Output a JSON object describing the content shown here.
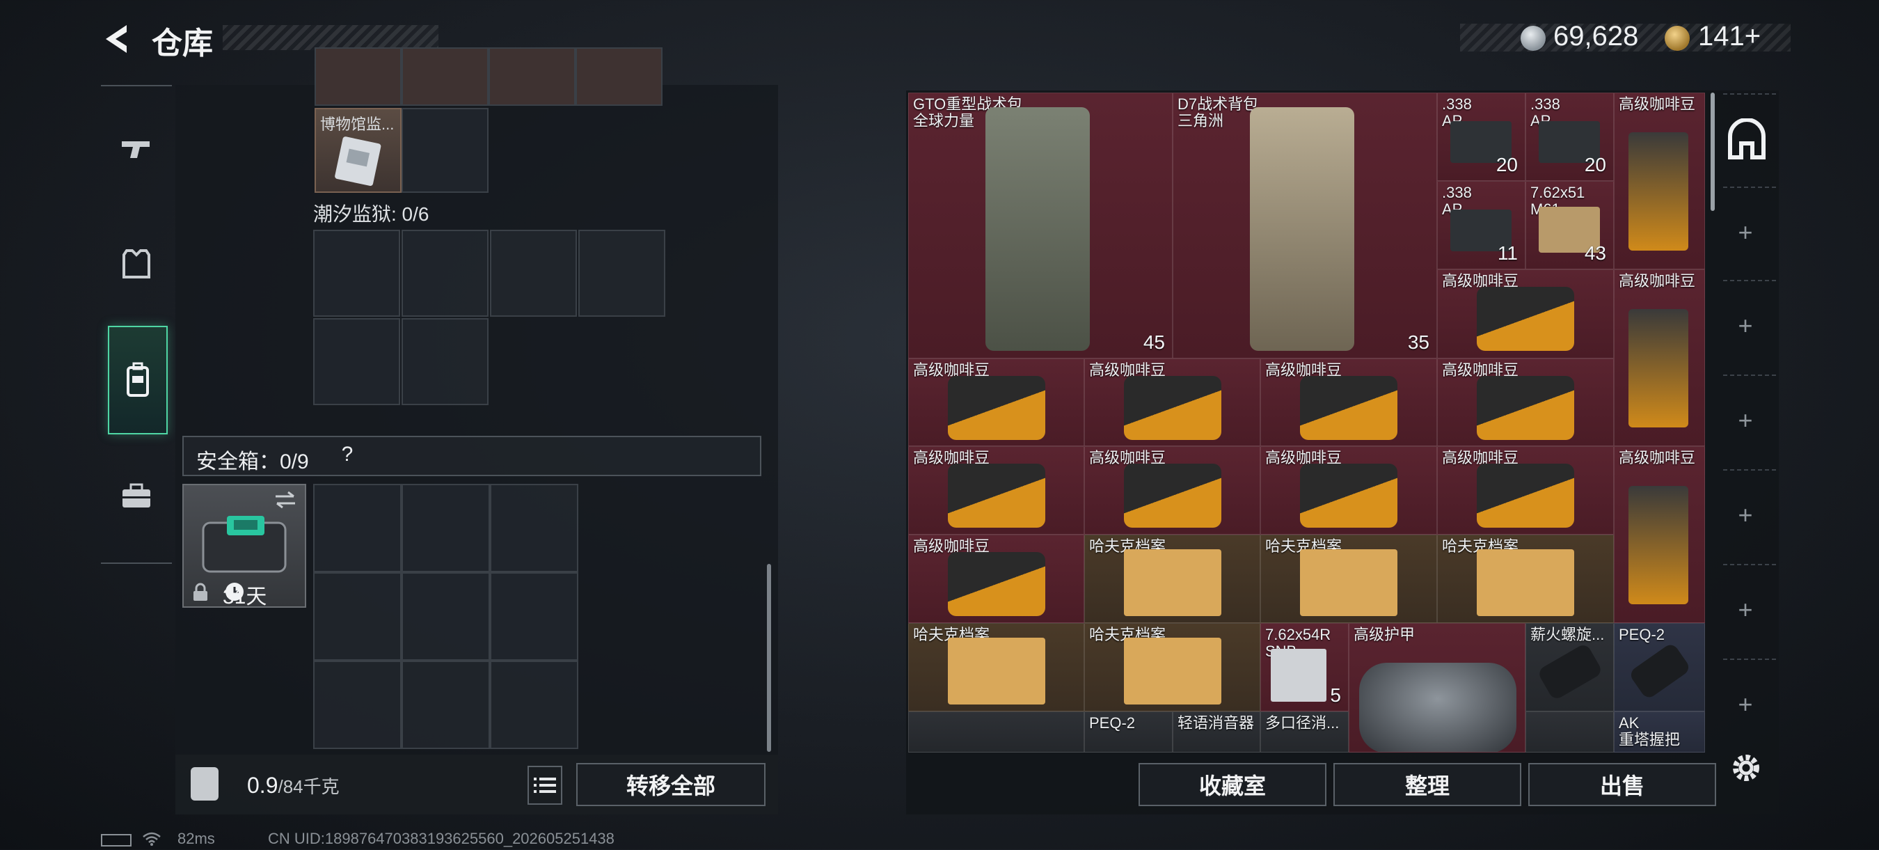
{
  "header": {
    "title": "仓库",
    "money": "69,628",
    "bonds": "141+"
  },
  "nav": {
    "items": [
      "weapons",
      "armor",
      "backpack",
      "toolbox"
    ]
  },
  "left": {
    "museum_item": "博物馆监...",
    "tide_prison": "潮汐监狱: 0/6",
    "safe_box_label": "安全箱：0/9",
    "help": "?",
    "safe_days": "31天",
    "weight_current": "0.9",
    "weight_max": "/84千克",
    "transfer_all": "转移全部"
  },
  "items": [
    {
      "name": "GTO重型战术包\n全球力量",
      "qty": "45"
    },
    {
      "name": "D7战术背包\n三角洲",
      "qty": "35"
    },
    {
      "name": ".338\nAP",
      "qty": "20"
    },
    {
      "name": ".338\nAP",
      "qty": "20"
    },
    {
      "name": "高级咖啡豆",
      "qty": ""
    },
    {
      "name": ".338\nAP",
      "qty": "11"
    },
    {
      "name": "7.62x51\nM61",
      "qty": "43"
    },
    {
      "name": "高级咖啡豆",
      "qty": ""
    },
    {
      "name": "高级咖啡豆",
      "qty": ""
    },
    {
      "name": "高级咖啡豆",
      "qty": ""
    },
    {
      "name": "高级咖啡豆",
      "qty": ""
    },
    {
      "name": "高级咖啡豆",
      "qty": ""
    },
    {
      "name": "高级咖啡豆",
      "qty": ""
    },
    {
      "name": "高级咖啡豆",
      "qty": ""
    },
    {
      "name": "高级咖啡豆",
      "qty": ""
    },
    {
      "name": "高级咖啡豆",
      "qty": ""
    },
    {
      "name": "高级咖啡豆",
      "qty": ""
    },
    {
      "name": "高级咖啡豆",
      "qty": ""
    },
    {
      "name": "高级咖啡豆",
      "qty": ""
    },
    {
      "name": "哈夫克档案",
      "qty": ""
    },
    {
      "name": "哈夫克档案",
      "qty": ""
    },
    {
      "name": "哈夫克档案",
      "qty": ""
    },
    {
      "name": "哈夫克档案",
      "qty": ""
    },
    {
      "name": "哈夫克档案",
      "qty": ""
    },
    {
      "name": "7.62x54R\nSNB",
      "qty": "5"
    },
    {
      "name": "高级护甲",
      "qty": ""
    },
    {
      "name": "薪火螺旋...",
      "qty": ""
    },
    {
      "name": "PEQ-2",
      "qty": ""
    },
    {
      "name": "PEQ-2",
      "qty": ""
    },
    {
      "name": "轻语消音器",
      "qty": ""
    },
    {
      "name": "多口径消...",
      "qty": ""
    },
    {
      "name": "AK\n重塔握把",
      "qty": ""
    }
  ],
  "actions": {
    "collection": "收藏室",
    "sort": "整理",
    "sell": "出售"
  },
  "footer": {
    "ping": "82ms",
    "uid": "CN UID:189876470383193625560_202605251438"
  }
}
